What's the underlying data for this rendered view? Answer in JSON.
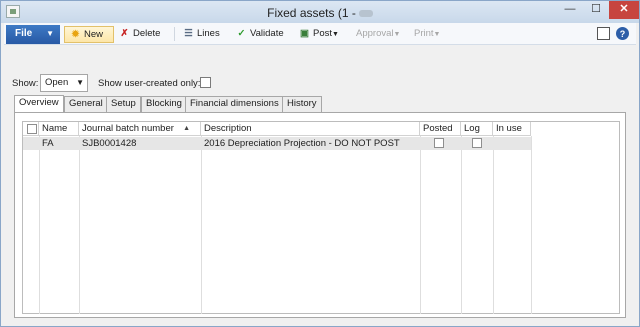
{
  "window": {
    "title": "Fixed assets (1 -",
    "minimize": "—",
    "maximize": "☐",
    "close": "✕"
  },
  "toolbar": {
    "file": "File",
    "new": "New",
    "delete": "Delete",
    "lines": "Lines",
    "validate": "Validate",
    "post": "Post",
    "approval": "Approval",
    "print": "Print",
    "help": "?"
  },
  "filters": {
    "show_label": "Show:",
    "show_value": "Open",
    "user_created_label": "Show user-created only:",
    "user_created_checked": false
  },
  "tabs": [
    "Overview",
    "General",
    "Setup",
    "Blocking",
    "Financial dimensions",
    "History"
  ],
  "active_tab": "Overview",
  "grid": {
    "columns": [
      "Name",
      "Journal batch number",
      "Description",
      "Posted",
      "Log",
      "In use"
    ],
    "sort_column": "Journal batch number",
    "rows": [
      {
        "name": "FA",
        "journal_batch_number": "SJB0001428",
        "description": "2016 Depreciation Projection - DO NOT POST",
        "posted": false,
        "log": false,
        "in_use": ""
      }
    ]
  },
  "icons": {
    "new": "sun-icon",
    "delete": "x-icon",
    "lines": "lines-icon",
    "validate": "checkmark-icon",
    "post": "post-icon",
    "help": "help-icon"
  },
  "colors": {
    "file_button": "#2d62ad",
    "new_highlight": "#fde6a8",
    "close_button": "#c7453f",
    "selected_row": "#e6e6e6"
  }
}
